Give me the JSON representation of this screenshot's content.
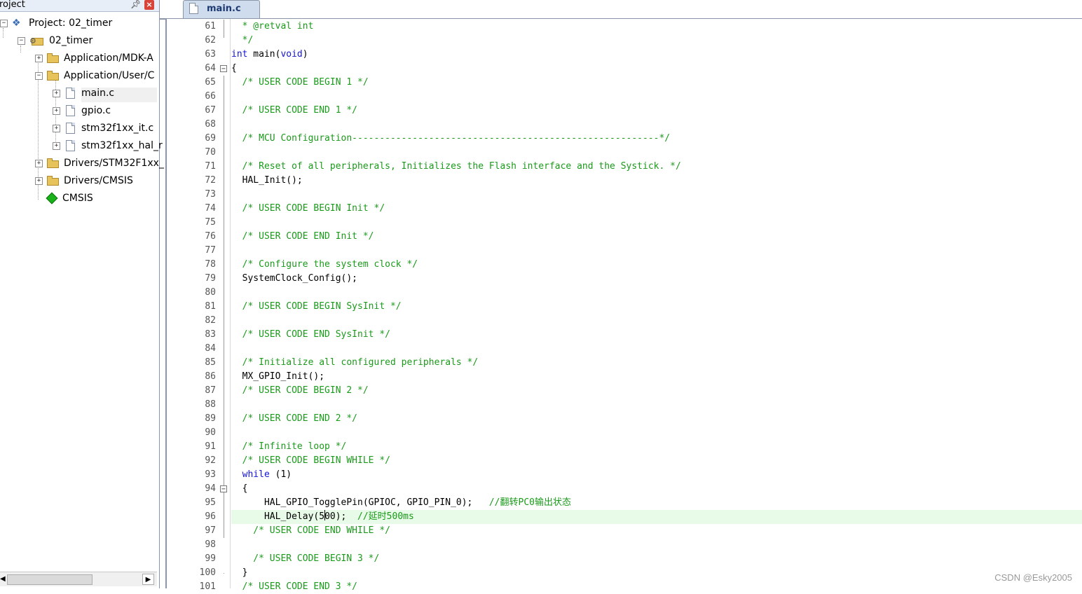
{
  "project_panel": {
    "title": "roject",
    "tree": [
      {
        "label": "Project: 02_timer",
        "icon": "project-icon",
        "expander": "⊟"
      },
      {
        "label": "02_timer",
        "icon": "target-folder-icon",
        "expander": "⊟"
      },
      {
        "label": "Application/MDK-A",
        "icon": "folder-icon",
        "expander": "+"
      },
      {
        "label": "Application/User/C",
        "icon": "folder-open-icon",
        "expander": "−"
      },
      {
        "label": "main.c",
        "icon": "file-icon",
        "expander": "+"
      },
      {
        "label": "gpio.c",
        "icon": "file-icon",
        "expander": "+"
      },
      {
        "label": "stm32f1xx_it.c",
        "icon": "file-icon",
        "expander": "+"
      },
      {
        "label": "stm32f1xx_hal_r",
        "icon": "file-icon",
        "expander": "+"
      },
      {
        "label": "Drivers/STM32F1xx_",
        "icon": "folder-icon",
        "expander": "+"
      },
      {
        "label": "Drivers/CMSIS",
        "icon": "folder-icon",
        "expander": "+"
      },
      {
        "label": "CMSIS",
        "icon": "cmsis-diamond-icon",
        "expander": ""
      }
    ]
  },
  "tabs": [
    {
      "label": "main.c",
      "active": true
    }
  ],
  "editor": {
    "current_line": 96,
    "lines": [
      {
        "n": "61",
        "parts": [
          {
            "t": "  * @retval int",
            "c": "com"
          }
        ]
      },
      {
        "n": "62",
        "parts": [
          {
            "t": "  */",
            "c": "com"
          }
        ]
      },
      {
        "n": "63",
        "parts": [
          {
            "t": "int",
            "c": "kw"
          },
          {
            "t": " main(",
            "c": ""
          },
          {
            "t": "void",
            "c": "kw"
          },
          {
            "t": ")",
            "c": ""
          }
        ]
      },
      {
        "n": "64",
        "parts": [
          {
            "t": "{",
            "c": ""
          }
        ]
      },
      {
        "n": "65",
        "parts": [
          {
            "t": "  /* USER CODE BEGIN 1 */",
            "c": "com"
          }
        ]
      },
      {
        "n": "66",
        "parts": []
      },
      {
        "n": "67",
        "parts": [
          {
            "t": "  /* USER CODE END 1 */",
            "c": "com"
          }
        ]
      },
      {
        "n": "68",
        "parts": []
      },
      {
        "n": "69",
        "parts": [
          {
            "t": "  /* MCU Configuration--------------------------------------------------------*/",
            "c": "com"
          }
        ]
      },
      {
        "n": "70",
        "parts": []
      },
      {
        "n": "71",
        "parts": [
          {
            "t": "  /* Reset of all peripherals, Initializes the Flash interface and the Systick. */",
            "c": "com"
          }
        ]
      },
      {
        "n": "72",
        "parts": [
          {
            "t": "  HAL_Init();",
            "c": ""
          }
        ]
      },
      {
        "n": "73",
        "parts": []
      },
      {
        "n": "74",
        "parts": [
          {
            "t": "  /* USER CODE BEGIN Init */",
            "c": "com"
          }
        ]
      },
      {
        "n": "75",
        "parts": []
      },
      {
        "n": "76",
        "parts": [
          {
            "t": "  /* USER CODE END Init */",
            "c": "com"
          }
        ]
      },
      {
        "n": "77",
        "parts": []
      },
      {
        "n": "78",
        "parts": [
          {
            "t": "  /* Configure the system clock */",
            "c": "com"
          }
        ]
      },
      {
        "n": "79",
        "parts": [
          {
            "t": "  SystemClock_Config();",
            "c": ""
          }
        ]
      },
      {
        "n": "80",
        "parts": []
      },
      {
        "n": "81",
        "parts": [
          {
            "t": "  /* USER CODE BEGIN SysInit */",
            "c": "com"
          }
        ]
      },
      {
        "n": "82",
        "parts": []
      },
      {
        "n": "83",
        "parts": [
          {
            "t": "  /* USER CODE END SysInit */",
            "c": "com"
          }
        ]
      },
      {
        "n": "84",
        "parts": []
      },
      {
        "n": "85",
        "parts": [
          {
            "t": "  /* Initialize all configured peripherals */",
            "c": "com"
          }
        ]
      },
      {
        "n": "86",
        "parts": [
          {
            "t": "  MX_GPIO_Init();",
            "c": ""
          }
        ]
      },
      {
        "n": "87",
        "parts": [
          {
            "t": "  /* USER CODE BEGIN 2 */",
            "c": "com"
          }
        ]
      },
      {
        "n": "88",
        "parts": []
      },
      {
        "n": "89",
        "parts": [
          {
            "t": "  /* USER CODE END 2 */",
            "c": "com"
          }
        ]
      },
      {
        "n": "90",
        "parts": []
      },
      {
        "n": "91",
        "parts": [
          {
            "t": "  /* Infinite loop */",
            "c": "com"
          }
        ]
      },
      {
        "n": "92",
        "parts": [
          {
            "t": "  /* USER CODE BEGIN WHILE */",
            "c": "com"
          }
        ]
      },
      {
        "n": "93",
        "parts": [
          {
            "t": "  ",
            "c": ""
          },
          {
            "t": "while",
            "c": "kw"
          },
          {
            "t": " (1)",
            "c": ""
          }
        ]
      },
      {
        "n": "94",
        "parts": [
          {
            "t": "  {",
            "c": ""
          }
        ]
      },
      {
        "n": "95",
        "parts": [
          {
            "t": "      HAL_GPIO_TogglePin(GPIOC, GPIO_PIN_0);   ",
            "c": ""
          },
          {
            "t": "//翻转PC0输出状态",
            "c": "com"
          }
        ]
      },
      {
        "n": "96",
        "parts": [
          {
            "t": "      HAL_Delay(5",
            "c": ""
          },
          {
            "t": "",
            "c": "caret"
          },
          {
            "t": "00);  ",
            "c": ""
          },
          {
            "t": "//延时500ms",
            "c": "com"
          }
        ]
      },
      {
        "n": "97",
        "parts": [
          {
            "t": "    /* USER CODE END WHILE */",
            "c": "com"
          }
        ]
      },
      {
        "n": "98",
        "parts": []
      },
      {
        "n": "99",
        "parts": [
          {
            "t": "    /* USER CODE BEGIN 3 */",
            "c": "com"
          }
        ]
      },
      {
        "n": "100",
        "parts": [
          {
            "t": "  }",
            "c": ""
          }
        ]
      },
      {
        "n": "101",
        "parts": [
          {
            "t": "  /* USER CODE END 3 */",
            "c": "com"
          }
        ]
      }
    ]
  },
  "watermark": "CSDN @Esky2005"
}
